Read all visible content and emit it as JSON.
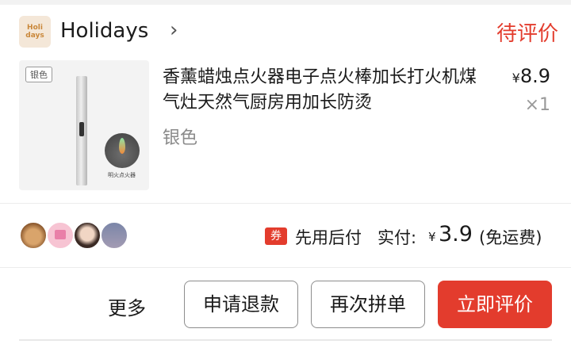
{
  "shop": {
    "logo_line1": "Holi",
    "logo_line2": "days",
    "name": "Holidays",
    "chevron": "›",
    "order_status": "待评价"
  },
  "product": {
    "thumb_tag": "银色",
    "thumb_caption": "明火点火器",
    "title": "香薰蜡烛点火器电子点火棒加长打火机煤气灶天然气厨房用加长防烫",
    "variant": "银色",
    "currency_symbol": "¥",
    "unit_price": "8.9",
    "quantity": "×1"
  },
  "payment": {
    "badge": "券",
    "pay_later_label": "先用后付",
    "paid_label": "实付:",
    "currency_symbol": "¥",
    "paid_amount": "3.9",
    "shipping_note": "(免运费)"
  },
  "actions": {
    "more": "更多",
    "refund": "申请退款",
    "rebuy": "再次拼单",
    "review": "立即评价"
  },
  "colors": {
    "accent": "#e33c2d",
    "muted_text": "#8a8a8a"
  }
}
